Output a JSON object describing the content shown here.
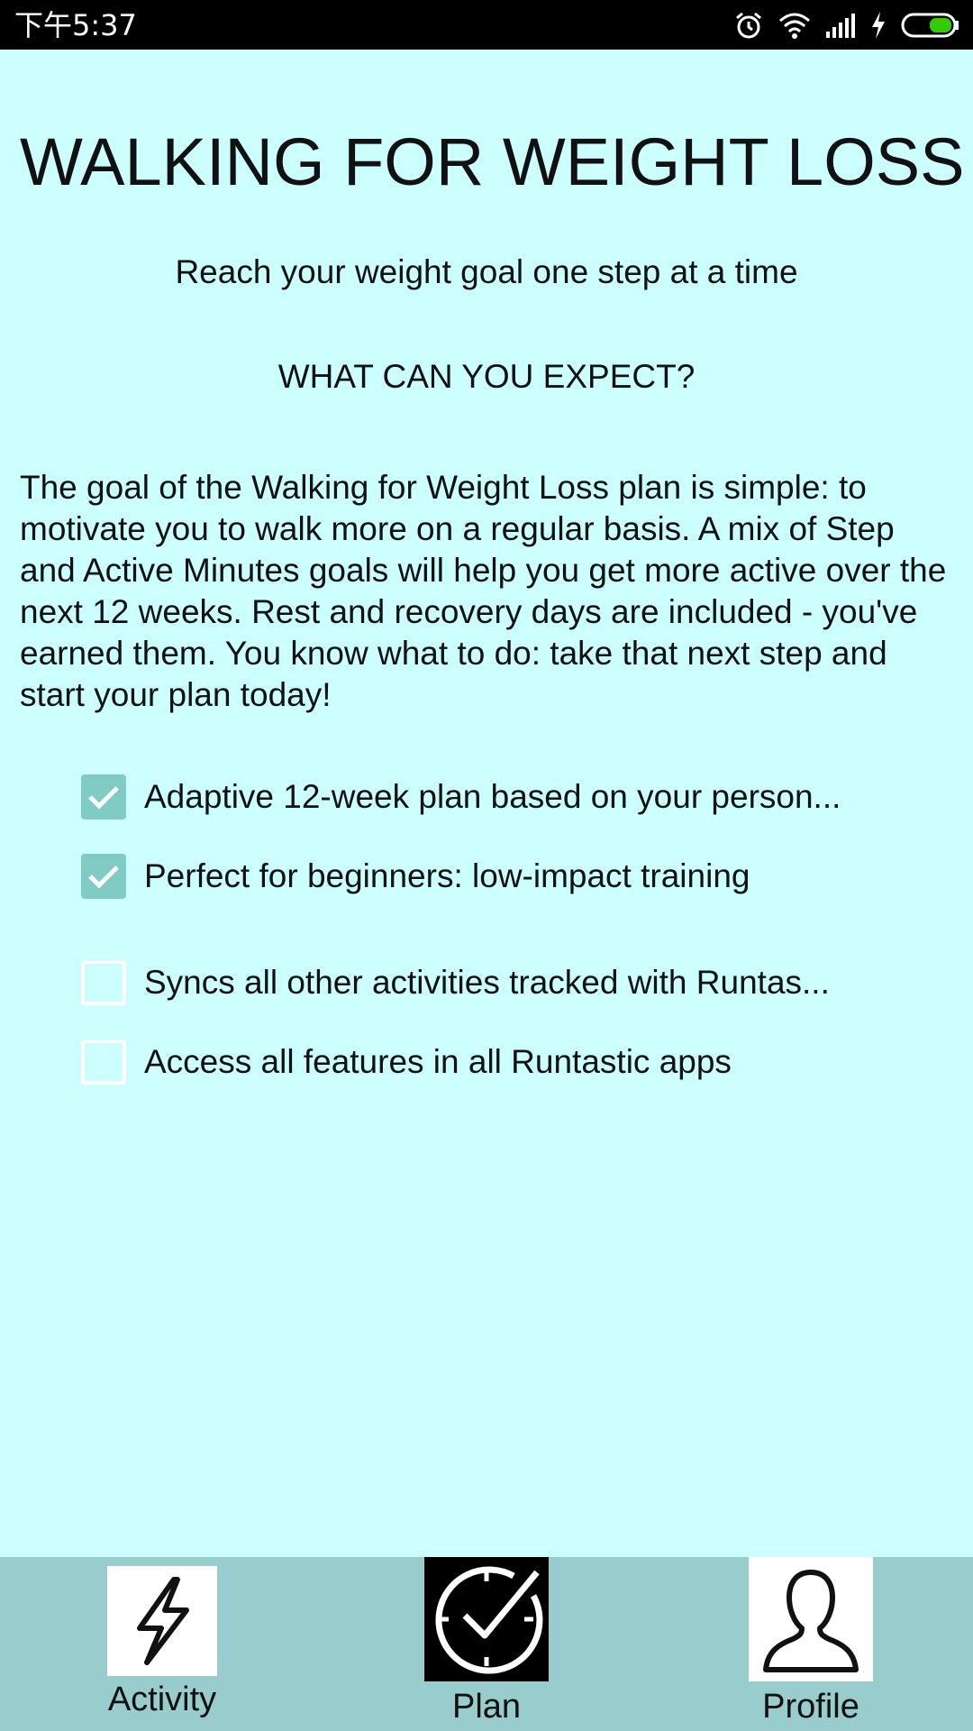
{
  "status_bar": {
    "time": "下午5:37",
    "icons": [
      "alarm-icon",
      "wifi-icon",
      "signal-icon",
      "charging-icon",
      "battery-icon"
    ],
    "battery_color": "#33cc00"
  },
  "page": {
    "title": "WALKING FOR WEIGHT LOSS",
    "subtitle": "Reach your weight goal one step at a time",
    "section_heading": "WHAT CAN YOU EXPECT?",
    "description": "The goal of the Walking for Weight Loss plan is simple: to motivate you to walk more on a regular basis. A mix of Step and Active Minutes goals will help you get more active over the next 12 weeks. Rest and recovery days are included - you've earned them. You know what to do: take that next step and start your plan today!"
  },
  "features": [
    {
      "label": "Adaptive 12-week plan based on your person...",
      "checked": true
    },
    {
      "label": "Perfect for beginners: low-impact training",
      "checked": true
    },
    {
      "label": "Syncs all other activities tracked with Runtas...",
      "checked": false
    },
    {
      "label": "Access all features in all Runtastic apps",
      "checked": false
    }
  ],
  "bottom_nav": {
    "items": [
      {
        "label": "Activity",
        "icon": "lightning-icon"
      },
      {
        "label": "Plan",
        "icon": "clock-check-icon"
      },
      {
        "label": "Profile",
        "icon": "user-icon"
      }
    ]
  },
  "colors": {
    "background": "#ccffff",
    "nav_background": "#99cccc",
    "checkbox_checked": "#80cbc4"
  }
}
